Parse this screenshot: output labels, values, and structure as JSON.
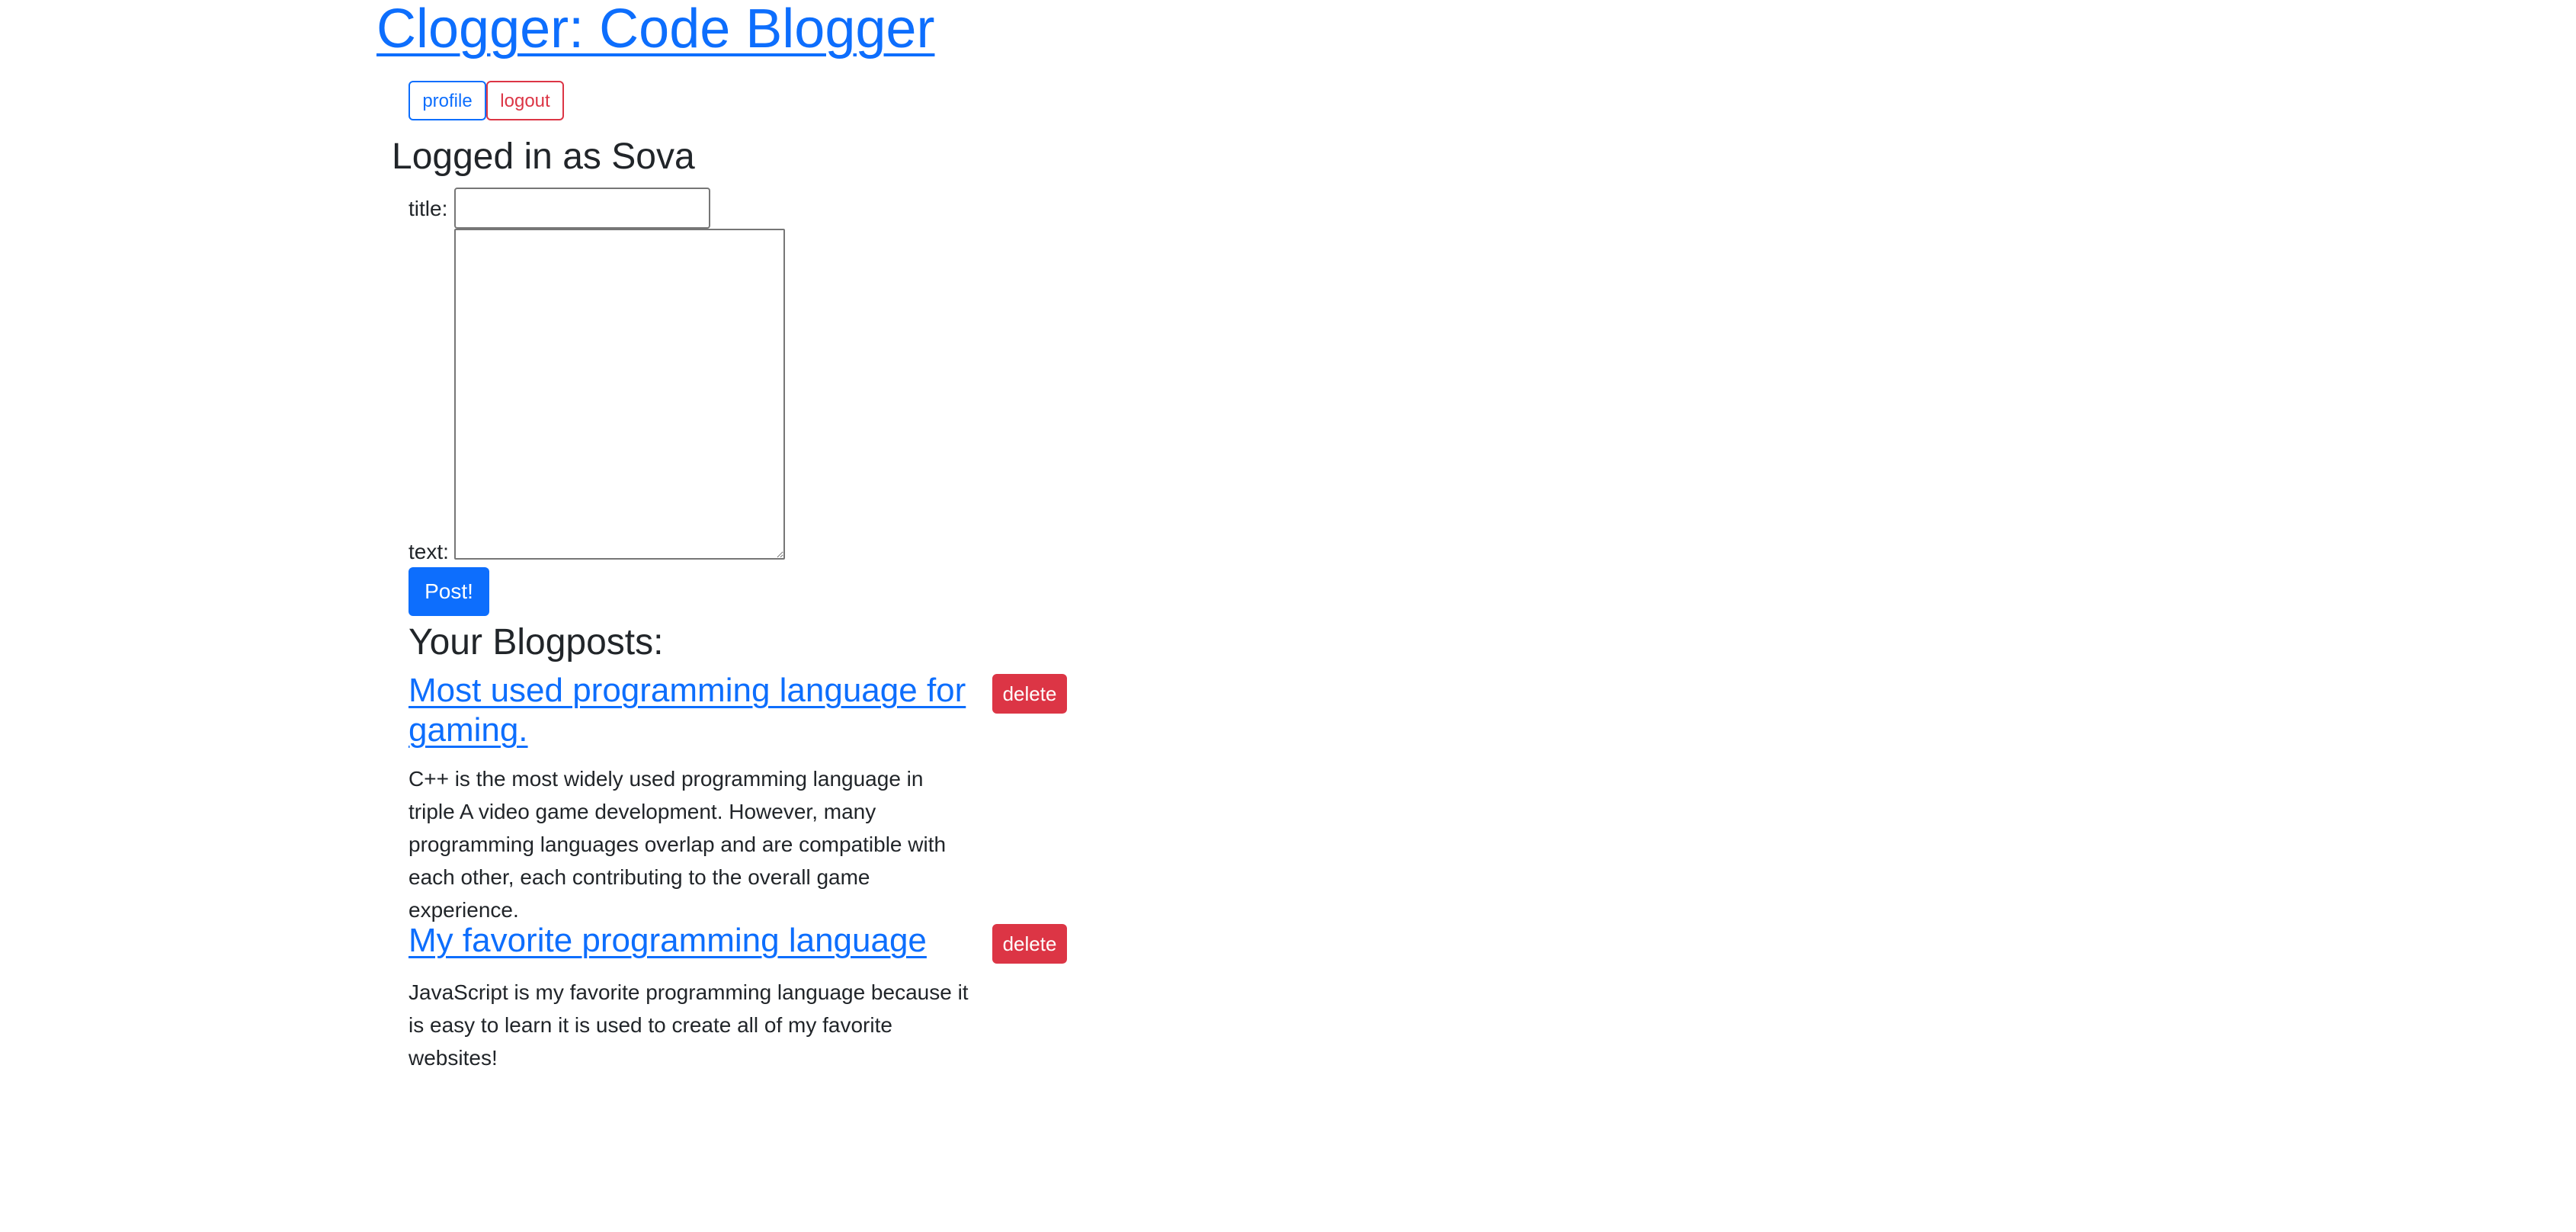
{
  "header": {
    "site_title": "Clogger: Code Blogger"
  },
  "nav": {
    "profile_label": "profile",
    "logout_label": "logout"
  },
  "user": {
    "logged_in_text": "Logged in as Sova"
  },
  "form": {
    "title_label": "title:",
    "title_value": "",
    "text_label": "text:",
    "text_value": "",
    "submit_label": "Post!"
  },
  "blogposts": {
    "heading": "Your Blogposts:",
    "delete_label": "delete",
    "items": [
      {
        "title": "Most used programming language for gaming.",
        "body": "C++ is the most widely used programming language in triple A video game development. However, many programming languages overlap and are compatible with each other, each contributing to the overall game experience."
      },
      {
        "title": "My favorite programming language",
        "body": "JavaScript is my favorite programming language because it is easy to learn it is used to create all of my favorite websites!"
      }
    ]
  },
  "colors": {
    "primary": "#0d6efd",
    "danger": "#dc3545",
    "text": "#212529",
    "background": "#ffffff"
  }
}
